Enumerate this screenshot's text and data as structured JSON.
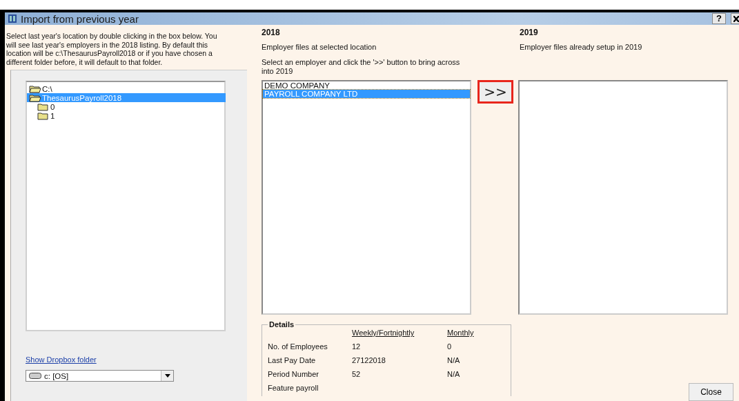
{
  "window": {
    "title": "Import from previous year",
    "help_button": "?"
  },
  "intro": "Select last year's location by double clicking in the box below. You will see last year's employers in the 2018 listing. By default this location will be c:\\ThesaurusPayroll2018 or if you have chosen a different folder before, it will default to that folder.",
  "folder_tree": [
    {
      "label": "C:\\",
      "selected": false,
      "expanded": true,
      "children": [
        {
          "label": "ThesaurusPayroll2018",
          "selected": true,
          "expanded": true,
          "children": [
            {
              "label": "0",
              "selected": false,
              "expanded": false
            },
            {
              "label": "1",
              "selected": false,
              "expanded": false
            }
          ]
        }
      ]
    }
  ],
  "dropbox_link": "Show Dropbox folder",
  "drive_dropdown": {
    "value": "c: [OS]"
  },
  "source": {
    "heading": "2018",
    "subtitle": "Employer files at selected location",
    "instruction": "Select an employer and click the '>>' button to bring across into 2019",
    "employers": [
      {
        "name": "DEMO COMPANY",
        "selected": false
      },
      {
        "name": "PAYROLL COMPANY LTD",
        "selected": true
      }
    ]
  },
  "transfer_button": {
    "label": ">>",
    "highlighted": true
  },
  "target": {
    "heading": "2019",
    "subtitle": "Employer files already setup in 2019"
  },
  "details": {
    "title": "Details",
    "columns": [
      "Weekly/Fortnightly",
      "Monthly"
    ],
    "rows": [
      {
        "label": "No. of Employees",
        "weekly": "12",
        "monthly": "0"
      },
      {
        "label": "Last Pay Date",
        "weekly": "27122018",
        "monthly": "N/A"
      },
      {
        "label": "Period Number",
        "weekly": "52",
        "monthly": "N/A"
      },
      {
        "label": "Feature payroll"
      }
    ]
  },
  "close_button": "Close"
}
